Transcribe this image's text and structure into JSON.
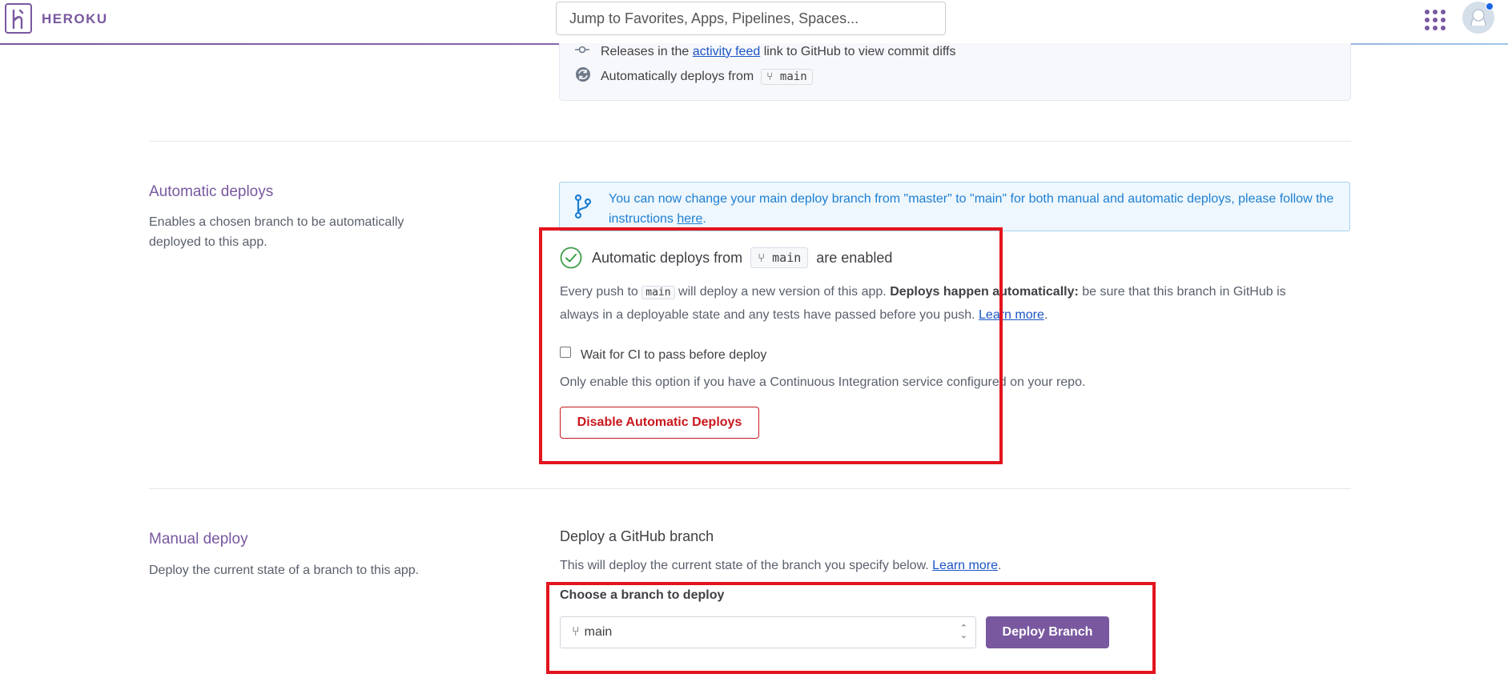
{
  "header": {
    "brand": "HEROKU",
    "search_placeholder": "Jump to Favorites, Apps, Pipelines, Spaces..."
  },
  "prior_section": {
    "releases_prefix": "Releases in the",
    "releases_link": "activity feed",
    "releases_suffix": "link to GitHub to view commit diffs",
    "auto_deploy_text": "Automatically deploys from",
    "branch": "main"
  },
  "automatic_deploys": {
    "title": "Automatic deploys",
    "description": "Enables a chosen branch to be automatically deployed to this app.",
    "info_text": "You can now change your main deploy branch from \"master\" to \"main\" for both manual and automatic deploys, please follow the instructions",
    "info_link": "here",
    "info_end": ".",
    "enabled_prefix": "Automatic deploys from",
    "enabled_branch": "main",
    "enabled_suffix": "are enabled",
    "push_prefix": "Every push to",
    "push_branch": "main",
    "push_middle": "will deploy a new version of this app.",
    "push_bold": "Deploys happen automatically:",
    "push_rest": "be sure that this branch in GitHub is",
    "push_line2": "always in a deployable state and any tests have passed before you push.",
    "learn_more": "Learn more",
    "period": ".",
    "ci_checkbox_label": "Wait for CI to pass before deploy",
    "ci_note": "Only enable this option if you have a Continuous Integration service configured on your repo.",
    "disable_button": "Disable Automatic Deploys"
  },
  "manual_deploy": {
    "title": "Manual deploy",
    "description": "Deploy the current state of a branch to this app.",
    "subheading": "Deploy a GitHub branch",
    "note": "This will deploy the current state of the branch you specify below.",
    "learn_more": "Learn more",
    "period": ".",
    "branch_label": "Choose a branch to deploy",
    "selected_branch": "main",
    "deploy_button": "Deploy Branch"
  },
  "colors": {
    "brand_purple": "#79589f",
    "link_blue": "#1a55c4",
    "danger_red": "#c9171d",
    "highlight_red": "#e3141d",
    "info_blue": "#1e7fd3"
  }
}
